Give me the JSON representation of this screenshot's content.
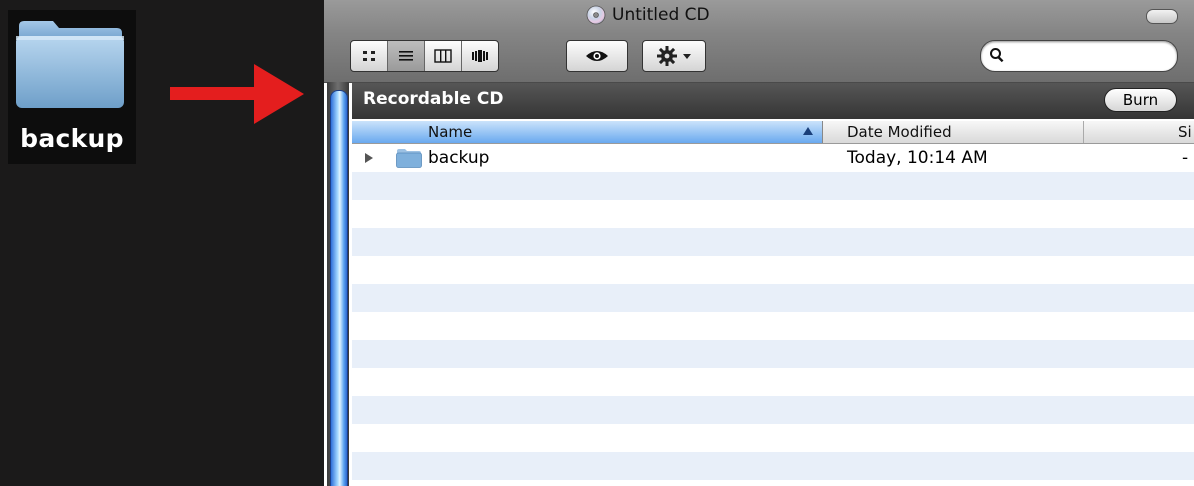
{
  "desktop": {
    "folder_label": "backup",
    "folder_icon": "folder-icon"
  },
  "annotations": {
    "arrow_color": "#e41e1e"
  },
  "window": {
    "title": "Untitled CD",
    "title_icon": "cd-icon",
    "view_modes": [
      "icon-view",
      "list-view",
      "column-view",
      "coverflow-view"
    ],
    "active_view": "list-view",
    "search": {
      "value": "",
      "placeholder": ""
    },
    "header_title": "Recordable CD",
    "burn_label": "Burn",
    "columns": {
      "name": "Name",
      "date": "Date Modified",
      "size": "Si"
    },
    "sort_column": "Name",
    "files": [
      {
        "name": "backup",
        "date": "Today, 10:14 AM",
        "size": "-"
      }
    ],
    "colors": {
      "stripe": "#e8eff9",
      "selected_header": "#6aa9ef",
      "scroll_thumb": "#5ba3f0"
    }
  }
}
